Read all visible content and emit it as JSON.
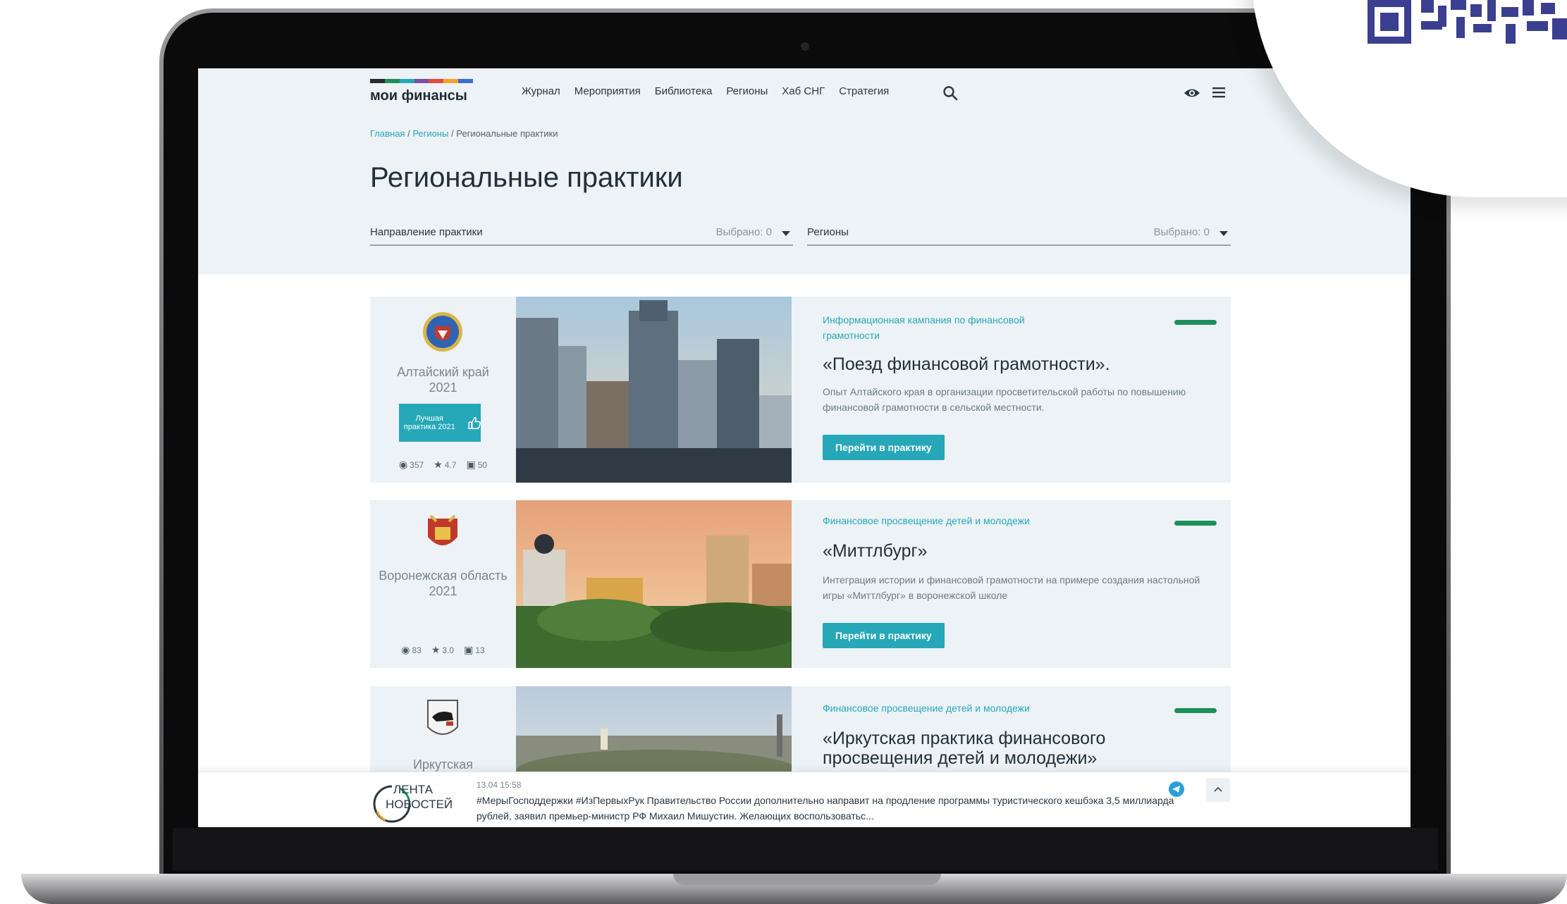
{
  "site": {
    "logo_text": "мои финансы",
    "logo_colors": [
      "#2a2a2a",
      "#1e8f5a",
      "#26a8b9",
      "#7a4fa0",
      "#e24a3b",
      "#f0a32b",
      "#3c6fd2"
    ],
    "accent_color": "#26a8b9"
  },
  "nav": {
    "items": [
      "Журнал",
      "Мероприятия",
      "Библиотека",
      "Регионы",
      "Хаб СНГ",
      "Стратегия"
    ]
  },
  "breadcrumb": {
    "home": "Главная",
    "regions": "Регионы",
    "current": "Региональные практики"
  },
  "page": {
    "title": "Региональные практики"
  },
  "filters": {
    "direction": {
      "label": "Направление практики",
      "selected": "Выбрано: 0"
    },
    "regions": {
      "label": "Регионы",
      "selected": "Выбрано: 0"
    }
  },
  "cards": [
    {
      "region": "Алтайский край",
      "year": "2021",
      "badge": "Лучшая практика 2021",
      "views": "357",
      "rating": "4.7",
      "saves": "50",
      "category": "Информационная кампания по финансовой грамотности",
      "title": "«Поезд финансовой грамотности».",
      "description": "Опыт Алтайского края в организации просветительской работы по повышению финансовой грамотности в сельской местности.",
      "button": "Перейти в практику"
    },
    {
      "region": "Воронежская область",
      "year": "2021",
      "views": "83",
      "rating": "3.0",
      "saves": "13",
      "category": "Финансовое просвещение детей и молодежи",
      "title": "«Миттлбург»",
      "description": "Интеграция истории и финансовой грамотности на примере создания настольной игры «Миттлбург» в воронежской школе",
      "button": "Перейти в практику"
    },
    {
      "region": "Иркутская",
      "category": "Финансовое просвещение детей и молодежи",
      "title": "«Иркутская практика финансового просвещения детей и молодежи»"
    }
  ],
  "ticker": {
    "brand_line1": "ЛЕНТА",
    "brand_line2": "НОВОСТЕЙ",
    "timestamp": "13.04 15:58",
    "text": "#МерыГосподдержки #ИзПервыхРук Правительство России дополнительно направит на продление программы туристического кешбэка 3,5 миллиарда рублей, заявил премьер-министр РФ Михаил Мишустин. Желающих воспользоватьс..."
  }
}
